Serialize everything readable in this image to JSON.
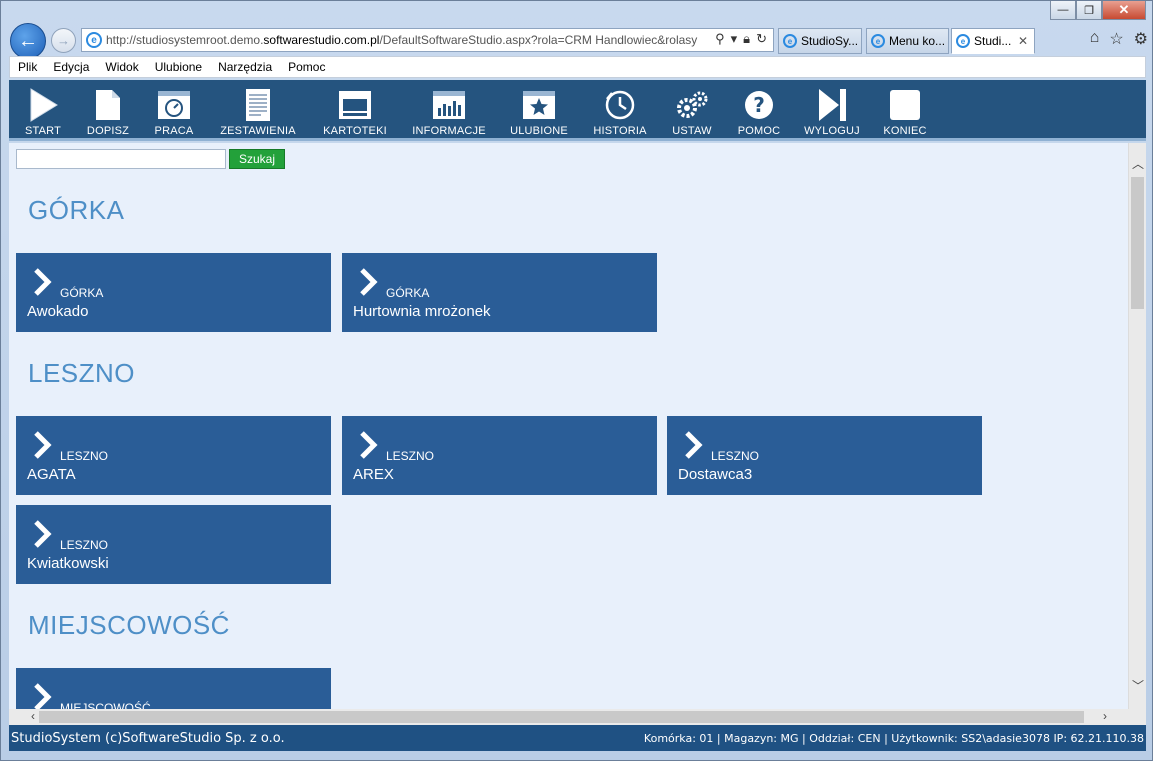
{
  "browser": {
    "url_prefix": "http://studiosystemroot.demo.",
    "url_domain": "softwarestudio.com.pl",
    "url_suffix": "/DefaultSoftwareStudio.aspx?rola=CRM Handlowiec&rolasy",
    "tabs": [
      {
        "label": "StudioSy..."
      },
      {
        "label": "Menu ko..."
      },
      {
        "label": "Studi..."
      }
    ]
  },
  "menu": [
    "Plik",
    "Edycja",
    "Widok",
    "Ulubione",
    "Narzędzia",
    "Pomoc"
  ],
  "toolbar": [
    {
      "label": "START",
      "icon": "play-icon"
    },
    {
      "label": "DOPISZ",
      "icon": "document-icon"
    },
    {
      "label": "PRACA",
      "icon": "dashboard-icon"
    },
    {
      "label": "ZESTAWIENIA",
      "icon": "report-icon"
    },
    {
      "label": "KARTOTEKI",
      "icon": "window-icon"
    },
    {
      "label": "INFORMACJE",
      "icon": "chart-icon"
    },
    {
      "label": "ULUBIONE",
      "icon": "star-icon"
    },
    {
      "label": "HISTORIA",
      "icon": "history-icon"
    },
    {
      "label": "USTAW",
      "icon": "gears-icon"
    },
    {
      "label": "POMOC",
      "icon": "help-icon"
    },
    {
      "label": "WYLOGUJ",
      "icon": "logout-icon"
    },
    {
      "label": "KONIEC",
      "icon": "stop-icon"
    }
  ],
  "search": {
    "button_label": "Szukaj",
    "value": ""
  },
  "sections": [
    {
      "title": "GÓRKA",
      "tiles": [
        {
          "category": "GÓRKA",
          "name": "Awokado"
        },
        {
          "category": "GÓRKA",
          "name": "Hurtownia mrożonek"
        }
      ]
    },
    {
      "title": "LESZNO",
      "tiles": [
        {
          "category": "LESZNO",
          "name": "AGATA"
        },
        {
          "category": "LESZNO",
          "name": "AREX"
        },
        {
          "category": "LESZNO",
          "name": "Dostawca3"
        },
        {
          "category": "LESZNO",
          "name": "Kwiatkowski"
        }
      ]
    },
    {
      "title": "MIEJSCOWOŚĆ",
      "tiles": [
        {
          "category": "MIEJSCOWOŚĆ",
          "name": ""
        }
      ]
    }
  ],
  "status": {
    "left": "StudioSystem (c)SoftwareStudio Sp. z o.o.",
    "right": "Komórka: 01 | Magazyn: MG | Oddział: CEN | Użytkownik: SS2\\adasie3078 IP: 62.21.110.38"
  },
  "colors": {
    "toolbar": "#25547f",
    "tile": "#2a5d97",
    "section_title": "#4e8fc7",
    "search_button": "#23a13a",
    "status_bar": "#1f5183"
  }
}
